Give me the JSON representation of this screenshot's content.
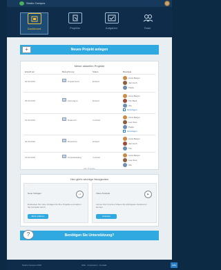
{
  "app": {
    "name": "Studio Campus"
  },
  "nav": [
    {
      "label": "Dashboard",
      "icon": "home-icon"
    },
    {
      "label": "Projekte",
      "icon": "projects-icon"
    },
    {
      "label": "Aufgaben",
      "icon": "tasks-icon"
    },
    {
      "label": "Team",
      "icon": "team-icon"
    }
  ],
  "new_project": {
    "label": "Neues Projekt anlegen"
  },
  "projects": {
    "title": "Meine aktuellen Projekte",
    "headers": [
      "Erstellt am",
      "Bezeichnung",
      "Status",
      "Beteiligte"
    ],
    "rows": [
      {
        "date": "02.04.2016",
        "name": "Projekt Nord",
        "status": "Entwurf",
        "members": [
          "Anna Berger",
          "Jan Koch",
          "Paula"
        ],
        "add": "hinzufügen"
      },
      {
        "date": "28.03.2016",
        "name": "Kampagne",
        "status": "Entwurf",
        "members": [
          "Anna Berger",
          "Tim Beck",
          "Ole"
        ],
        "add": "hinzufügen"
      },
      {
        "date": "14.03.2016",
        "name": "Relaunch",
        "status": "In Arbeit",
        "members": [
          "Anna Berger",
          "Lea Voss",
          "Paula"
        ],
        "add": "hinzufügen"
      },
      {
        "date": "02.03.2016",
        "name": "Broschüre",
        "status": "Entwurf",
        "members": [
          "Anna Berger",
          "Jan Koch",
          "Tim"
        ],
        "add": "hinzufügen"
      },
      {
        "date": "19.02.2016",
        "name": "Produktkatalog",
        "status": "In Arbeit",
        "members": [
          "Anna Berger",
          "Lea Voss",
          "Ole"
        ],
        "add": ""
      }
    ],
    "footer": "alle Projekte"
  },
  "tips": {
    "title": "Hier gibt's wichtige Neuigkeiten",
    "items": [
      {
        "title": "Neue Vorlagen",
        "body": "Entdecken Sie neue Vorlagen für Ihre Projekte und starten Sie schneller durch.",
        "button": "Mehr erfahren",
        "icon": "+1"
      },
      {
        "title": "Video-Tutorials",
        "body": "Lernen Sie in kurzen Videos die wichtigsten Funktionen kennen.",
        "button": "Ansehen",
        "icon": "▶"
      }
    ]
  },
  "help": {
    "label": "Benötigen Sie Unterstützung?"
  },
  "footer": {
    "left": "Studio Campus 2016",
    "middle": "Hilfe · Impressum · Kontakt",
    "badge": "Hilfe"
  }
}
